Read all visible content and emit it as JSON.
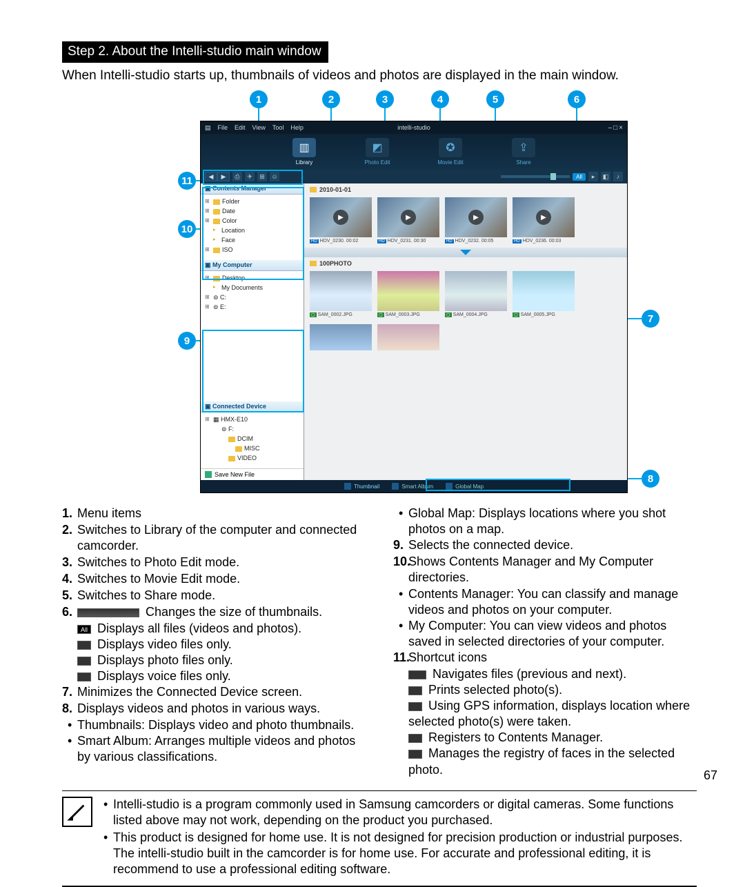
{
  "heading": "Step 2. About the Intelli-studio main window",
  "intro": "When Intelli-studio starts up, thumbnails of videos and photos are displayed in the main window.",
  "page_number": "67",
  "callouts": [
    "1",
    "2",
    "3",
    "4",
    "5",
    "6",
    "7",
    "8",
    "9",
    "10",
    "11"
  ],
  "app": {
    "menu": [
      "File",
      "Edit",
      "View",
      "Tool",
      "Help"
    ],
    "title": "intelli-studio",
    "window_controls": [
      "–",
      "□",
      "×"
    ],
    "modes": [
      {
        "label": "Library",
        "selected": true
      },
      {
        "label": "Photo Edit",
        "selected": false
      },
      {
        "label": "Movie Edit",
        "selected": false
      },
      {
        "label": "Share",
        "selected": false
      }
    ],
    "filter_all": "All",
    "panels": {
      "contents_manager": {
        "title": "Contents Manager",
        "nodes": [
          "Folder",
          "Date",
          "Color",
          "Location",
          "Face",
          "ISO"
        ]
      },
      "my_computer": {
        "title": "My Computer",
        "nodes": [
          "Desktop",
          "My Documents",
          "C:",
          "E:"
        ]
      },
      "connected_device": {
        "title": "Connected Device",
        "root": "HMX-E10",
        "children": [
          "F:",
          "DCIM",
          "MISC",
          "VIDEO"
        ]
      },
      "save_new_file": "Save New File"
    },
    "sections": {
      "date_header": "2010-01-01",
      "thumbs_top": [
        {
          "name": "HDV_0230.",
          "dur": "00:02"
        },
        {
          "name": "HDV_0231.",
          "dur": "00:30"
        },
        {
          "name": "HDV_0232.",
          "dur": "00:05"
        },
        {
          "name": "HDV_0236.",
          "dur": "00:03"
        }
      ],
      "photo_header": "100PHOTO",
      "thumbs_photo": [
        {
          "name": "SAM_0002.JPG"
        },
        {
          "name": "SAM_0003.JPG"
        },
        {
          "name": "SAM_0004.JPG"
        },
        {
          "name": "SAM_0005.JPG"
        }
      ]
    },
    "footer_tabs": [
      {
        "label": "Thumbnail",
        "selected": true
      },
      {
        "label": "Smart Album",
        "selected": false
      },
      {
        "label": "Global Map",
        "selected": false
      }
    ]
  },
  "legend_left": [
    {
      "n": "1.",
      "t": "Menu items"
    },
    {
      "n": "2.",
      "t": "Switches to Library of the computer and connected camcorder."
    },
    {
      "n": "3.",
      "t": "Switches to Photo Edit mode."
    },
    {
      "n": "4.",
      "t": "Switches to Movie Edit mode."
    },
    {
      "n": "5.",
      "t": "Switches to Share mode."
    },
    {
      "n": "6.",
      "t": "Changes the size of thumbnails.",
      "icon": "sl",
      "subs": [
        {
          "icon": "all",
          "t": "Displays all files (videos and photos)."
        },
        {
          "icon": "box",
          "t": "Displays video files only."
        },
        {
          "icon": "box",
          "t": "Displays photo files only."
        },
        {
          "icon": "box",
          "t": "Displays voice files only."
        }
      ]
    },
    {
      "n": "7.",
      "t": "Minimizes the Connected Device screen."
    },
    {
      "n": "8.",
      "t": "Displays videos and photos in various ways.",
      "subs": [
        {
          "t": "Thumbnails: Displays video and photo thumbnails."
        },
        {
          "t": "Smart Album: Arranges multiple videos and photos by various classifications."
        }
      ]
    }
  ],
  "legend_right": [
    {
      "sub": true,
      "t": "Global Map: Displays locations where you shot photos on a map."
    },
    {
      "n": "9.",
      "t": "Selects the connected device."
    },
    {
      "n": "10.",
      "t": "Shows Contents Manager and My Computer directories.",
      "subs": [
        {
          "t": "Contents Manager: You can classify and manage videos and photos on your computer."
        },
        {
          "t": "My Computer: You can view videos and photos saved in selected directories of your computer."
        }
      ]
    },
    {
      "n": "11.",
      "t": "Shortcut icons",
      "subs": [
        {
          "icon": "nav",
          "t": "Navigates files (previous and next)."
        },
        {
          "icon": "box",
          "t": "Prints selected photo(s)."
        },
        {
          "icon": "box",
          "t": "Using GPS information, displays location where selected photo(s) were taken."
        },
        {
          "icon": "box",
          "t": "Registers to Contents Manager."
        },
        {
          "icon": "box",
          "t": "Manages the registry of faces in the selected photo."
        }
      ]
    }
  ],
  "notes": [
    "Intelli-studio is a program commonly used in Samsung camcorders or digital cameras. Some functions listed above may not work, depending on the product you purchased.",
    "This product is designed for home use. It is not designed for precision production or industrial purposes. The intelli-studio built in the camcorder is for home use. For accurate and professional editing, it is recommend to use a professional editing software."
  ]
}
